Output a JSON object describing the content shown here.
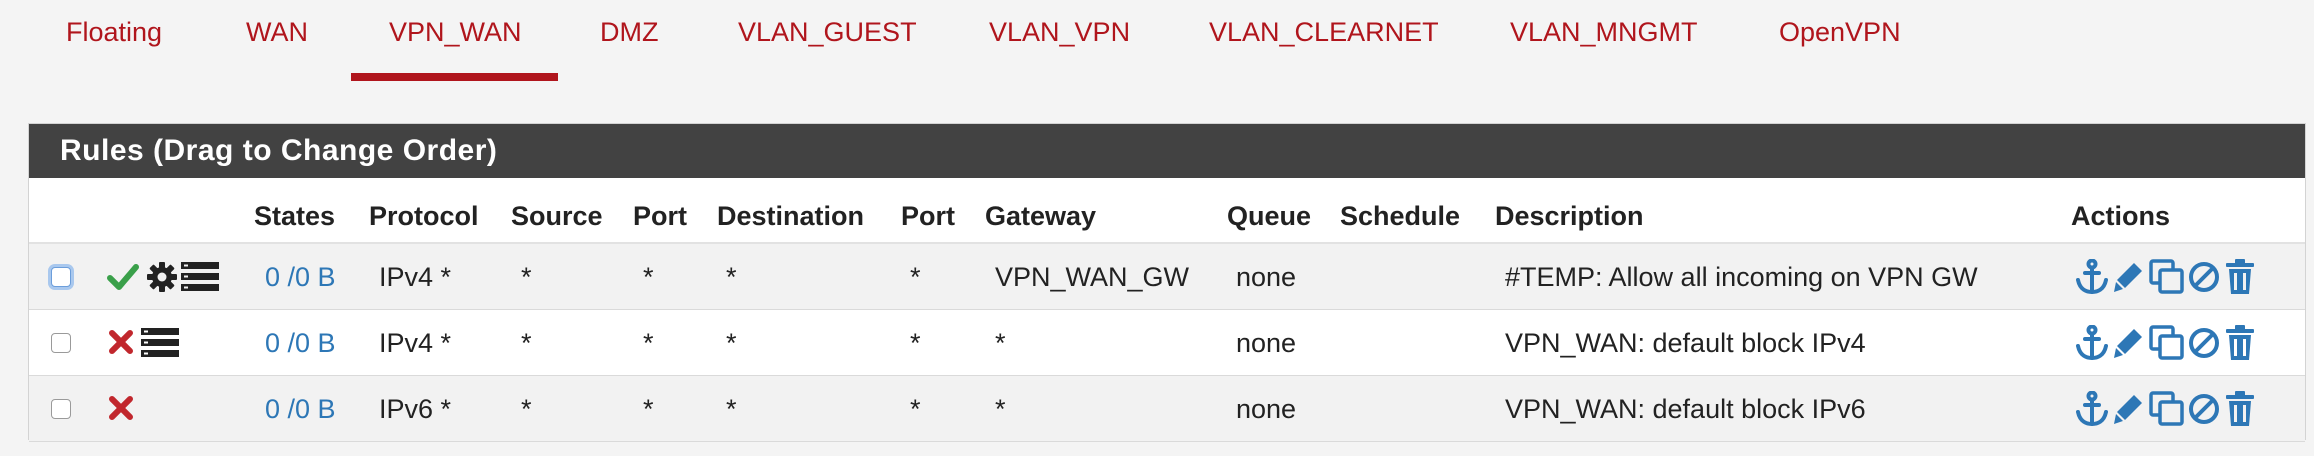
{
  "tabs": [
    {
      "label": "Floating"
    },
    {
      "label": "WAN"
    },
    {
      "label": "VPN_WAN",
      "active": true
    },
    {
      "label": "DMZ"
    },
    {
      "label": "VLAN_GUEST"
    },
    {
      "label": "VLAN_VPN"
    },
    {
      "label": "VLAN_CLEARNET"
    },
    {
      "label": "VLAN_MNGMT"
    },
    {
      "label": "OpenVPN"
    }
  ],
  "panel": {
    "title": "Rules (Drag to Change Order)",
    "headers": {
      "states": "States",
      "protocol": "Protocol",
      "source": "Source",
      "port": "Port",
      "destination": "Destination",
      "port2": "Port",
      "gateway": "Gateway",
      "queue": "Queue",
      "schedule": "Schedule",
      "description": "Description",
      "actions": "Actions"
    }
  },
  "rules": [
    {
      "status": "pass",
      "extra_icons": [
        "gear-icon",
        "advanced-options-icon"
      ],
      "states": "0 /0 B",
      "protocol": "IPv4 *",
      "source": "*",
      "port": "*",
      "destination": "*",
      "dest_port": "*",
      "gateway": "VPN_WAN_GW",
      "queue": "none",
      "schedule": "",
      "description": "#TEMP: Allow all incoming on VPN GW"
    },
    {
      "status": "block",
      "extra_icons": [
        "advanced-options-icon"
      ],
      "states": "0 /0 B",
      "protocol": "IPv4 *",
      "source": "*",
      "port": "*",
      "destination": "*",
      "dest_port": "*",
      "gateway": "*",
      "queue": "none",
      "schedule": "",
      "description": "VPN_WAN: default block IPv4"
    },
    {
      "status": "block",
      "extra_icons": [],
      "states": "0 /0 B",
      "protocol": "IPv6 *",
      "source": "*",
      "port": "*",
      "destination": "*",
      "dest_port": "*",
      "gateway": "*",
      "queue": "none",
      "schedule": "",
      "description": "VPN_WAN: default block IPv6"
    }
  ],
  "colors": {
    "accent": "#b0151c",
    "link": "#2d77b6",
    "pass": "#3aa04a",
    "block": "#c1272d",
    "heading_bg": "#424242"
  }
}
